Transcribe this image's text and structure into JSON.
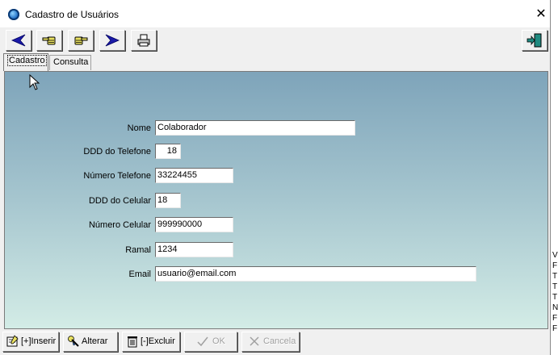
{
  "window": {
    "title": "Cadastro de Usuários",
    "close_glyph": "✕"
  },
  "toolbar": {
    "buttons": [
      {
        "icon": "arrow-left-icon",
        "color": "#1a1aa8"
      },
      {
        "icon": "hand-point-left-icon"
      },
      {
        "icon": "hand-point-right-icon"
      },
      {
        "icon": "arrow-right-icon",
        "color": "#1a1aa8"
      },
      {
        "icon": "printer-icon"
      },
      {
        "icon": "exit-door-icon",
        "color": "#1f8a80"
      }
    ]
  },
  "tabs": [
    {
      "label": "Cadastro",
      "active": true
    },
    {
      "label": "Consulta",
      "active": false
    }
  ],
  "form": {
    "fields": [
      {
        "label": "Nome",
        "value": "Colaborador"
      },
      {
        "label": "DDD do Telefone",
        "value": "18"
      },
      {
        "label": "Número Telefone",
        "value": "33224455"
      },
      {
        "label": "DDD do Celular",
        "value": "18"
      },
      {
        "label": "Número Celular",
        "value": "999990000"
      },
      {
        "label": "Ramal",
        "value": "1234"
      },
      {
        "label": "Email",
        "value": "usuario@email.com"
      }
    ]
  },
  "bottom_buttons": {
    "inserir": {
      "prefix": "[+]",
      "label": "Inserir",
      "enabled": true
    },
    "alterar": {
      "label": "Alterar",
      "enabled": true
    },
    "excluir": {
      "prefix": "[-]",
      "label": "Excluir",
      "enabled": true
    },
    "ok": {
      "label": "OK",
      "enabled": false
    },
    "cancela": {
      "label": "Cancela",
      "enabled": false
    }
  },
  "side_text": [
    "V",
    "F",
    "T",
    "T",
    "T",
    "N",
    "F",
    "F"
  ],
  "colors": {
    "panel_top": "#7ea4ba",
    "panel_bottom": "#d3ece6",
    "disabled_text": "#a0a0a0"
  }
}
